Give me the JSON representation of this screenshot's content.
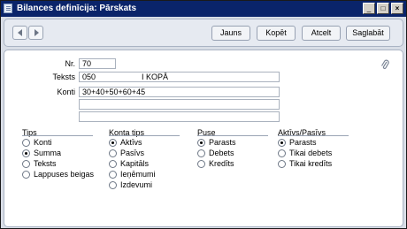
{
  "window": {
    "title": "Bilances definīcija: Pārskats",
    "minimize_glyph": "_",
    "maximize_glyph": "□",
    "close_glyph": "×"
  },
  "toolbar": {
    "prev_icon": "arrow-left-icon",
    "next_icon": "arrow-right-icon",
    "buttons": {
      "new": "Jauns",
      "copy": "Kopēt",
      "cancel": "Atcelt",
      "save": "Saglabāt"
    }
  },
  "form": {
    "nr": {
      "label": "Nr.",
      "value": "70"
    },
    "text": {
      "label": "Teksts",
      "value_code": "050",
      "value_title": "I KOPĀ"
    },
    "accounts": {
      "label": "Konti",
      "values": [
        "30+40+50+60+45",
        "",
        ""
      ]
    },
    "attachment_icon": "paperclip-icon"
  },
  "groups": {
    "tips": {
      "title": "Tips",
      "options": [
        "Konti",
        "Summa",
        "Teksts",
        "Lappuses beigas"
      ],
      "selected": "Summa"
    },
    "konta_tips": {
      "title": "Konta tips",
      "options": [
        "Aktīvs",
        "Pasīvs",
        "Kapitāls",
        "Ieņēmumi",
        "Izdevumi"
      ],
      "selected": "Aktīvs"
    },
    "puse": {
      "title": "Puse",
      "options": [
        "Parasts",
        "Debets",
        "Kredīts"
      ],
      "selected": "Parasts"
    },
    "aktivs_pasivs": {
      "title": "Aktīvs/Pasīvs",
      "options": [
        "Parasts",
        "Tikai debets",
        "Tikai kredīts"
      ],
      "selected": "Parasts"
    }
  }
}
